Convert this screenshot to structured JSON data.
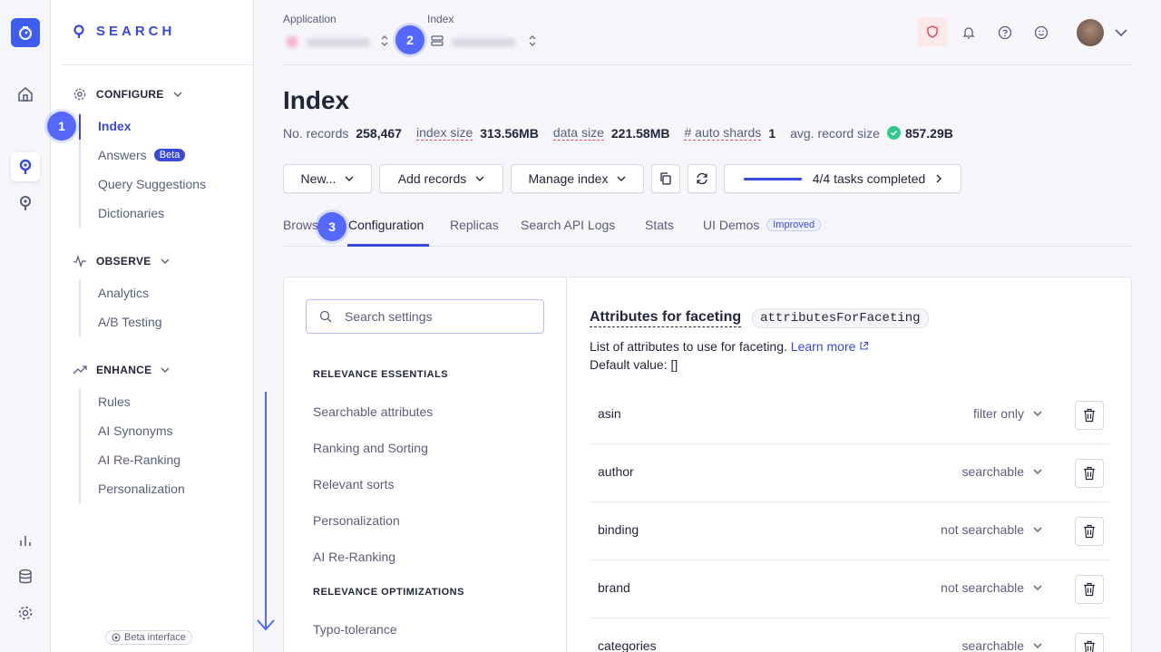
{
  "brand": {
    "name": "SEARCH"
  },
  "sidebar": {
    "sections": [
      {
        "title": "CONFIGURE",
        "items": [
          {
            "label": "Index",
            "active": true
          },
          {
            "label": "Answers",
            "badge": "Beta"
          },
          {
            "label": "Query Suggestions"
          },
          {
            "label": "Dictionaries"
          }
        ]
      },
      {
        "title": "OBSERVE",
        "items": [
          {
            "label": "Analytics"
          },
          {
            "label": "A/B Testing"
          }
        ]
      },
      {
        "title": "ENHANCE",
        "items": [
          {
            "label": "Rules"
          },
          {
            "label": "AI Synonyms"
          },
          {
            "label": "AI Re-Ranking"
          },
          {
            "label": "Personalization"
          }
        ]
      }
    ],
    "beta_interface": "Beta interface"
  },
  "steps": [
    "1",
    "2",
    "3"
  ],
  "topbar": {
    "application_label": "Application",
    "index_label": "Index"
  },
  "page": {
    "title": "Index",
    "stats": {
      "records_label": "No. records",
      "records_value": "258,467",
      "index_size_label": "index size",
      "index_size_value": "313.56MB",
      "data_size_label": "data size",
      "data_size_value": "221.58MB",
      "shards_label": "# auto shards",
      "shards_value": "1",
      "avg_label": "avg. record size",
      "avg_value": "857.29B"
    }
  },
  "toolbar": {
    "new_label": "New...",
    "add_records_label": "Add records",
    "manage_index_label": "Manage index",
    "tasks_label": "4/4 tasks completed",
    "tasks_progress": 1.0
  },
  "tabs": [
    {
      "label": "Brows"
    },
    {
      "label": "Configuration",
      "active": true
    },
    {
      "label": "Replicas"
    },
    {
      "label": "Search API Logs"
    },
    {
      "label": "Stats"
    },
    {
      "label": "UI Demos",
      "badge": "Improved"
    }
  ],
  "settings": {
    "search_placeholder": "Search settings",
    "groups": [
      {
        "title": "RELEVANCE ESSENTIALS",
        "items": [
          "Searchable attributes",
          "Ranking and Sorting",
          "Relevant sorts",
          "Personalization",
          "AI Re-Ranking"
        ]
      },
      {
        "title": "RELEVANCE OPTIMIZATIONS",
        "items": [
          "Typo-tolerance"
        ]
      }
    ]
  },
  "facets": {
    "title": "Attributes for faceting",
    "code": "attributesForFaceting",
    "description": "List of attributes to use for faceting.",
    "learn_more": "Learn more",
    "default_value": "Default value: []",
    "rows": [
      {
        "name": "asin",
        "mode": "filter only"
      },
      {
        "name": "author",
        "mode": "searchable"
      },
      {
        "name": "binding",
        "mode": "not searchable"
      },
      {
        "name": "brand",
        "mode": "not searchable"
      },
      {
        "name": "categories",
        "mode": "searchable"
      }
    ]
  },
  "colors": {
    "accent": "#3a4ad8",
    "step": "#5468ff",
    "success": "#2fc88a"
  }
}
